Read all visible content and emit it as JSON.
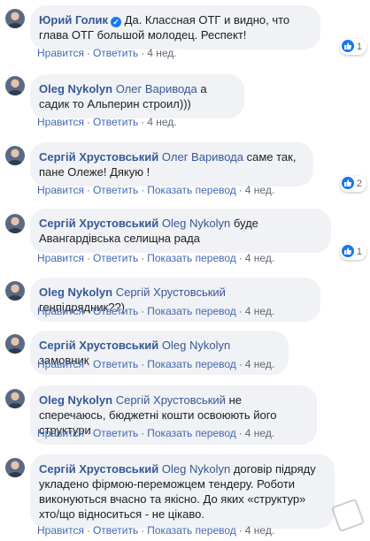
{
  "actions": {
    "like": "Нравится",
    "reply": "Ответить",
    "translate": "Показать перевод",
    "sep": "·"
  },
  "comments": [
    {
      "author": "Юрий Голик",
      "verified": true,
      "mention": "",
      "text": "Да. Классная ОТГ и видно, что глава ОТГ большой молодец. Респект!",
      "time": "4 нед.",
      "reactions": "1"
    },
    {
      "author": "Oleg Nykolyn",
      "mention": "Олег Варивода",
      "text": "а садик то Альперин строил)))",
      "time": "4 нед."
    },
    {
      "author": "Сергій Хрустовський",
      "mention": "Олег Варивода",
      "text": "саме так, пане Олеже! Дякую !",
      "time": "4 нед.",
      "reactions": "2"
    },
    {
      "author": "Сергій Хрустовський",
      "mention": "Oleg Nykolyn",
      "text": "буде Авангардівська селищна рада",
      "time": "4 нед.",
      "reactions": "1"
    },
    {
      "author": "Oleg Nykolyn",
      "mention": "Сергій Хрустовський",
      "text": "генпідрядник??)",
      "time": "4 нед."
    },
    {
      "author": "Сергій Хрустовський",
      "mention": "Oleg Nykolyn",
      "text": "замовник",
      "time": "4 нед."
    },
    {
      "author": "Oleg Nykolyn",
      "mention": "Сергій Хрустовський",
      "text": "не сперечаюсь, бюджетні кошти освоюють його структури",
      "time": "4 нед."
    },
    {
      "author": "Сергій Хрустовський",
      "mention": "Oleg Nykolyn",
      "text": "договір підряду укладено фірмою-переможцем тендеру. Роботи виконуються вчасно та якісно. До яких «структур» хто/що відноситься - не цікаво.",
      "time": "4 нед."
    }
  ]
}
